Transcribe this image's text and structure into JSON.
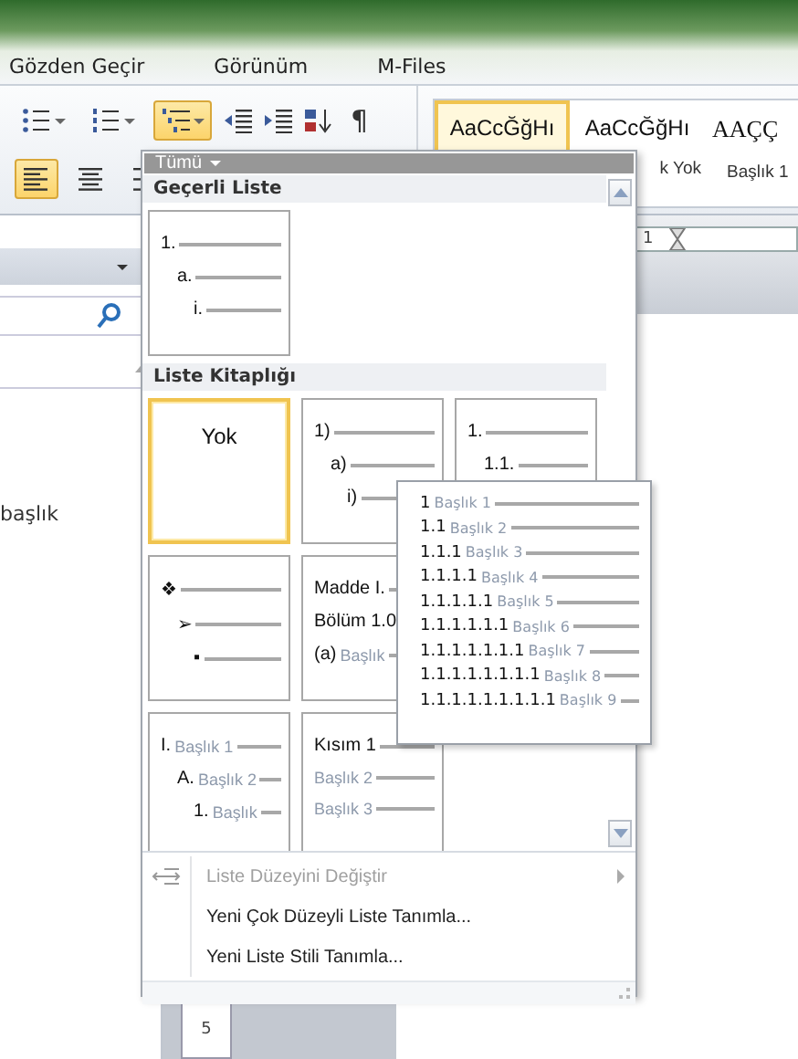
{
  "tabs": [
    {
      "label": "Gözden Geçir",
      "selected": false
    },
    {
      "label": "Görünüm",
      "selected": false
    },
    {
      "label": "M-Files",
      "selected": false
    }
  ],
  "ribbon": {
    "list_buttons": [
      {
        "kind": "bullets",
        "selected": false
      },
      {
        "kind": "numbered",
        "selected": false
      },
      {
        "kind": "multilevel",
        "selected": true
      }
    ],
    "align_buttons": [
      {
        "kind": "left",
        "selected": true
      },
      {
        "kind": "center",
        "selected": false
      },
      {
        "kind": "right",
        "selected": false
      }
    ],
    "pilcrow": "¶",
    "styles": [
      {
        "sample": "AaCcĞğHı",
        "selected": true,
        "kind": "body"
      },
      {
        "sample": "AaCcĞğHı",
        "label": "k Yok",
        "selected": false,
        "kind": "body"
      },
      {
        "sample": "AAÇÇ",
        "label": "Başlık 1",
        "selected": false,
        "kind": "heading"
      }
    ]
  },
  "side_pane": {
    "text": "başlık"
  },
  "menu": {
    "filter": "Tümü",
    "current_heading": "Geçerli Liste",
    "current": {
      "kind": "stepped",
      "selected": false,
      "lines": [
        {
          "number": "1."
        },
        {
          "number": "a."
        },
        {
          "number": "i."
        }
      ]
    },
    "library_heading": "Liste Kitaplığı",
    "library": [
      {
        "kind": "text",
        "text": "Yok",
        "selected": true
      },
      {
        "kind": "stepped",
        "selected": false,
        "lines": [
          {
            "number": "1)"
          },
          {
            "number": "a)"
          },
          {
            "number": "i)"
          }
        ]
      },
      {
        "kind": "stepped",
        "selected": false,
        "lines": [
          {
            "number": "1."
          },
          {
            "number": "1.1."
          }
        ]
      },
      {
        "kind": "stepped",
        "selected": false,
        "lines": [
          {
            "number": "❖"
          },
          {
            "number": "➢"
          },
          {
            "number": "▪"
          }
        ]
      },
      {
        "kind": "flat",
        "selected": false,
        "lines": [
          {
            "number": "Madde I."
          },
          {
            "number": "Bölüm 1.0"
          },
          {
            "number": "(a)",
            "heading": "Başlık"
          }
        ]
      },
      {
        "kind": "hidden"
      },
      {
        "kind": "stepped",
        "selected": false,
        "lines": [
          {
            "number": "I.",
            "heading": "Başlık 1"
          },
          {
            "number": "A.",
            "heading": "Başlık 2"
          },
          {
            "number": "1.",
            "heading": "Başlık"
          }
        ]
      },
      {
        "kind": "flat",
        "selected": false,
        "lines": [
          {
            "number": "Kısım 1"
          },
          {
            "heading": "Başlık 2"
          },
          {
            "heading": "Başlık 3"
          }
        ]
      }
    ],
    "items": [
      {
        "label": "Liste Düzeyini Değiştir",
        "disabled": true,
        "submenu": true,
        "icon": true
      },
      {
        "label": "Yeni Çok Düzeyli Liste Tanımla...",
        "disabled": false,
        "submenu": false,
        "icon": false
      },
      {
        "label": "Yeni Liste Stili Tanımla...",
        "disabled": false,
        "submenu": false,
        "icon": false
      }
    ]
  },
  "preview": {
    "lines": [
      {
        "number": "1",
        "heading": "Başlık 1"
      },
      {
        "number": "1.1",
        "heading": "Başlık 2"
      },
      {
        "number": "1.1.1",
        "heading": "Başlık 3"
      },
      {
        "number": "1.1.1.1",
        "heading": "Başlık 4"
      },
      {
        "number": "1.1.1.1.1",
        "heading": "Başlık 5"
      },
      {
        "number": "1.1.1.1.1.1",
        "heading": "Başlık 6"
      },
      {
        "number": "1.1.1.1.1.1.1",
        "heading": "Başlık 7"
      },
      {
        "number": "1.1.1.1.1.1.1.1",
        "heading": "Başlık 8"
      },
      {
        "number": "1.1.1.1.1.1.1.1.1",
        "heading": "Başlık 9"
      }
    ]
  },
  "ruler": {
    "mark": "1"
  },
  "vruler": {
    "mark": "5"
  }
}
